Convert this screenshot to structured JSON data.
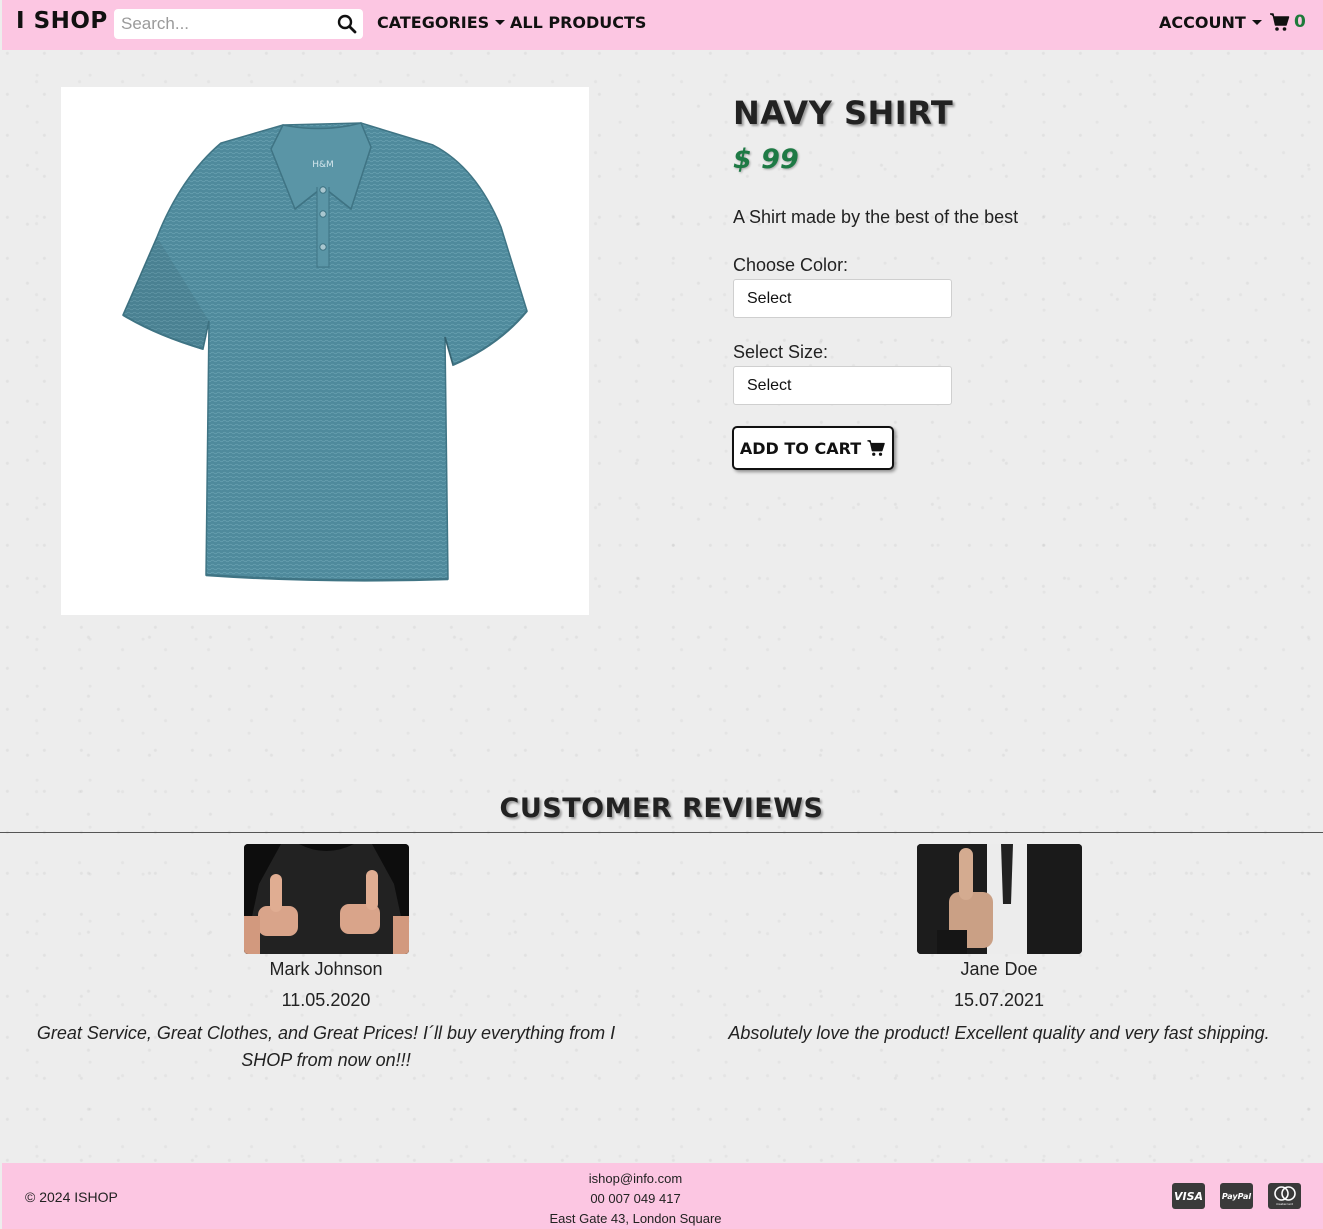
{
  "navbar": {
    "brand": "I SHOP",
    "search_placeholder": "Search...",
    "categories_label": "CATEGORIES",
    "all_products_label": "ALL PRODUCTS",
    "account_label": "ACCOUNT",
    "cart_count": "0"
  },
  "product": {
    "title": "NAVY SHIRT",
    "price": "$ 99",
    "description": "A Shirt made by the best of the best",
    "color_label": "Choose Color:",
    "color_value": "Select",
    "size_label": "Select Size:",
    "size_value": "Select",
    "add_to_cart_label": "ADD TO CART",
    "shirt_logo": "H&M"
  },
  "reviews": {
    "title": "CUSTOMER REVIEWS",
    "items": [
      {
        "name": "Mark Johnson",
        "date": "11.05.2020",
        "text": "Great Service, Great Clothes, and Great Prices! I´ll buy everything from I SHOP from now on!!!"
      },
      {
        "name": "Jane Doe",
        "date": "15.07.2021",
        "text": "Absolutely love the product! Excellent quality and very fast shipping."
      }
    ]
  },
  "footer": {
    "copyright": "© 2024 ISHOP",
    "email": "ishop@info.com",
    "phone": "00 007 049 417",
    "address": "East Gate 43, London Square",
    "payments": [
      "VISA",
      "PayPal",
      "mastercard"
    ]
  },
  "colors": {
    "navbar_bg": "#fcc6e2",
    "price_green": "#1e7a45",
    "cart_count_green": "#1e7a3a",
    "shirt_teal": "#4f8a9c"
  },
  "icons": [
    "search-icon",
    "caret-down-icon",
    "cart-icon",
    "visa-icon",
    "paypal-icon",
    "mastercard-icon"
  ]
}
